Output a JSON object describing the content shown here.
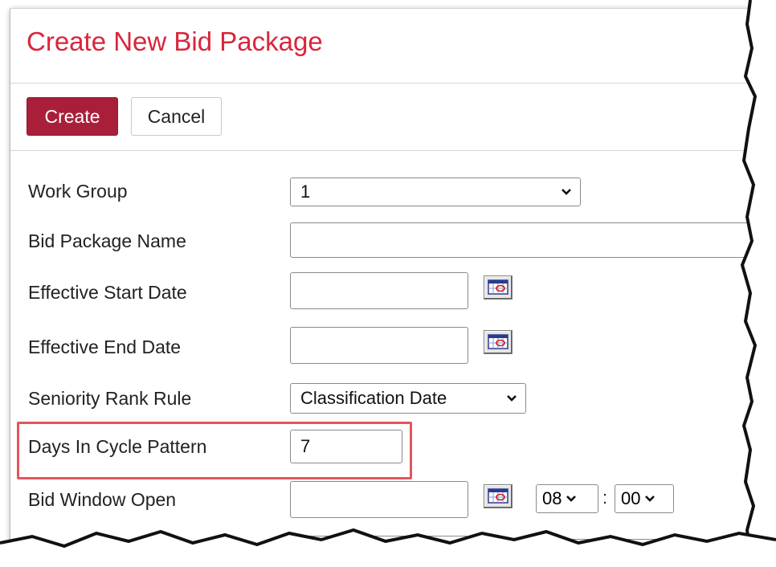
{
  "page": {
    "title": "Create New Bid Package"
  },
  "toolbar": {
    "create_label": "Create",
    "cancel_label": "Cancel"
  },
  "form": {
    "work_group": {
      "label": "Work Group",
      "value": "1"
    },
    "bid_package_name": {
      "label": "Bid Package Name",
      "value": ""
    },
    "effective_start_date": {
      "label": "Effective Start Date",
      "value": ""
    },
    "effective_end_date": {
      "label": "Effective End Date",
      "value": ""
    },
    "seniority_rank_rule": {
      "label": "Seniority Rank Rule",
      "value": "Classification Date"
    },
    "days_in_cycle_pattern": {
      "label": "Days In Cycle Pattern",
      "value": "7"
    },
    "bid_window_open": {
      "label": "Bid Window Open",
      "value": "",
      "hour": "08",
      "minute": "00",
      "separator": ":"
    }
  },
  "colors": {
    "title": "#d8263c",
    "create_button": "#a91f39",
    "highlight_border": "#e4555c"
  }
}
